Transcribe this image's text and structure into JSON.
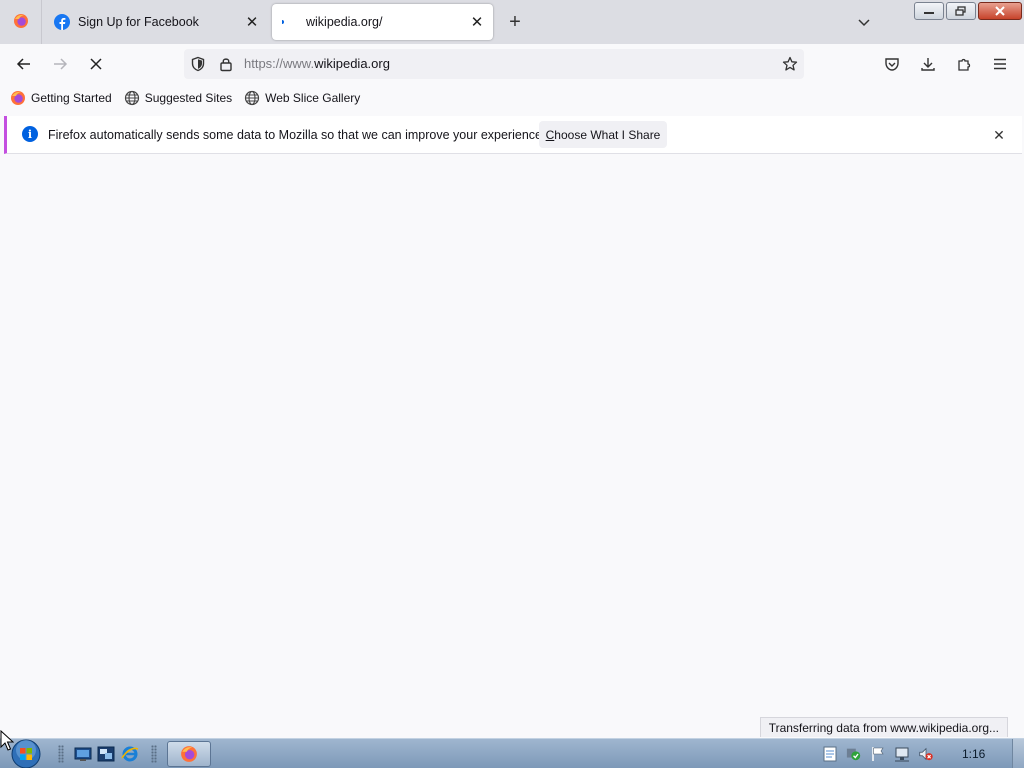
{
  "tabs": [
    {
      "title": "Sign Up for Facebook",
      "icon": "facebook-icon",
      "active": false
    },
    {
      "title": "wikipedia.org/",
      "icon": "loading-dot-icon",
      "active": true
    }
  ],
  "toolbar": {
    "url_prefix": "https://www.",
    "url_domain": "wikipedia.org"
  },
  "bookmarks": [
    {
      "label": "Getting Started",
      "icon": "firefox-icon"
    },
    {
      "label": "Suggested Sites",
      "icon": "globe-icon"
    },
    {
      "label": "Web Slice Gallery",
      "icon": "globe-icon"
    }
  ],
  "notification": {
    "message": "Firefox automatically sends some data to Mozilla so that we can improve your experience.",
    "button_label": "Choose What I Share"
  },
  "status": {
    "text": "Transferring data from www.wikipedia.org..."
  },
  "taskbar": {
    "clock": "1:16"
  },
  "colors": {
    "notification_accent": "#c44fe0",
    "info_icon": "#0061e0",
    "facebook_blue": "#1877f2"
  }
}
